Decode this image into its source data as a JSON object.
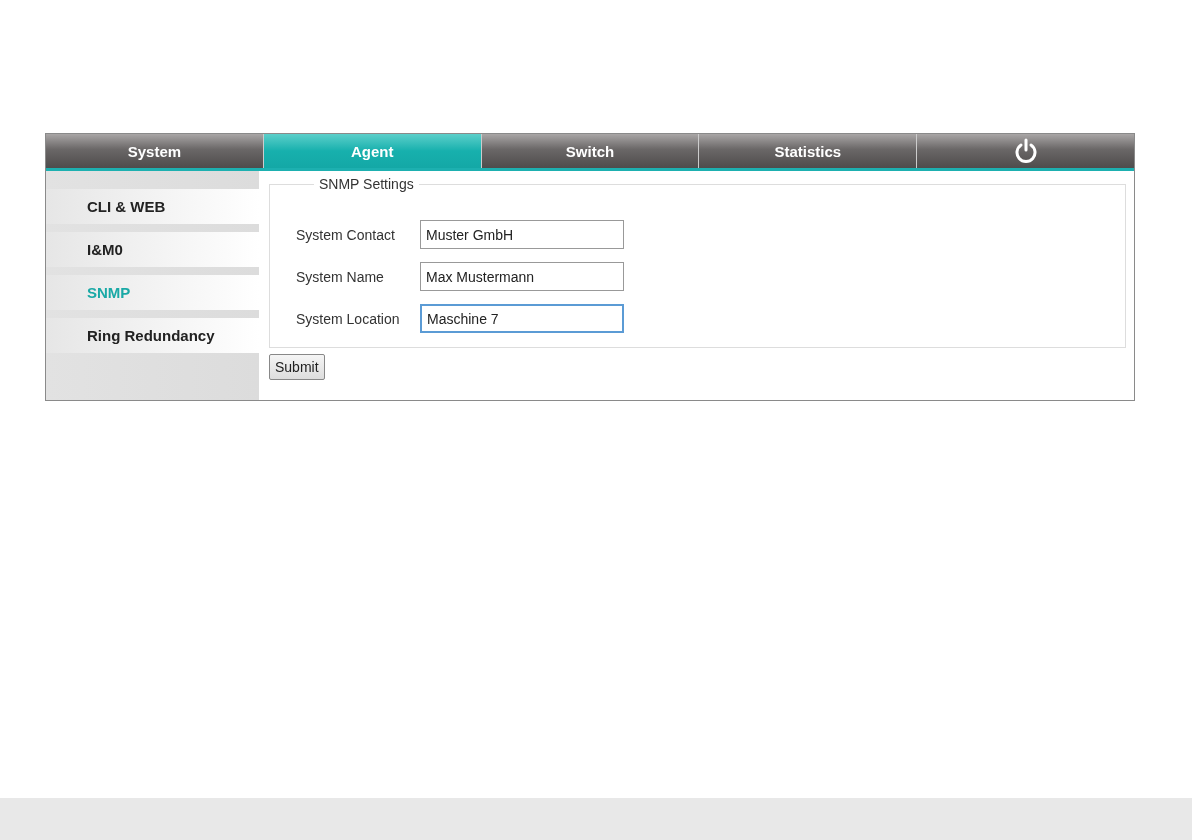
{
  "tabs": [
    {
      "kind": "text",
      "label": "System",
      "selected": false
    },
    {
      "kind": "text",
      "label": "Agent",
      "selected": true
    },
    {
      "kind": "text",
      "label": "Switch",
      "selected": false
    },
    {
      "kind": "text",
      "label": "Statistics",
      "selected": false
    },
    {
      "kind": "power",
      "selected": false
    }
  ],
  "sidebar": {
    "items": [
      {
        "label": "CLI & WEB",
        "selected": false
      },
      {
        "label": "I&M0",
        "selected": false
      },
      {
        "label": "SNMP",
        "selected": true
      },
      {
        "label": "Ring Redundancy",
        "selected": false
      }
    ]
  },
  "snmp_settings": {
    "legend": "SNMP Settings",
    "fields": [
      {
        "label": "System Contact",
        "value": "Muster GmbH",
        "focused": false
      },
      {
        "label": "System Name",
        "value": "Max Mustermann",
        "focused": false
      },
      {
        "label": "System Location",
        "value": "Maschine 7",
        "focused": true
      }
    ],
    "submit": "Submit"
  }
}
